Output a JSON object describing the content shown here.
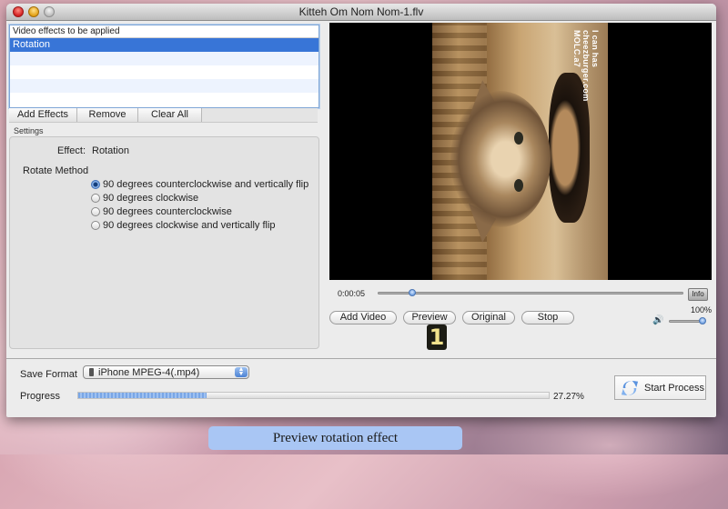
{
  "window": {
    "title": "Kitteh Om Nom Nom-1.flv"
  },
  "effects": {
    "header": "Video effects to be applied",
    "items": [
      "Rotation"
    ],
    "selected_index": 0,
    "buttons": {
      "add": "Add Effects",
      "remove": "Remove",
      "clear": "Clear All"
    }
  },
  "settings": {
    "title": "Settings",
    "effect_key": "Effect:",
    "effect_value": "Rotation",
    "rotate_label": "Rotate Method",
    "options": [
      {
        "label": "90 degrees counterclockwise and vertically flip",
        "selected": true
      },
      {
        "label": "90 degrees clockwise",
        "selected": false
      },
      {
        "label": "90 degrees counterclockwise",
        "selected": false
      },
      {
        "label": "90 degrees clockwise and vertically flip",
        "selected": false
      }
    ]
  },
  "player": {
    "watermark": "I can has cheezburger.com MOLC.a7",
    "time": "0:00:05",
    "seek_fraction": 0.1,
    "info_label": "Info",
    "buttons": {
      "add_video": "Add Video",
      "preview": "Preview",
      "original": "Original",
      "stop": "Stop"
    },
    "volume_label": "100%",
    "volume_fraction": 1.0,
    "speaker_icon": "speaker-icon"
  },
  "step_badge": "1",
  "output": {
    "save_format_label": "Save Format",
    "save_format_value": "iPhone MPEG-4(.mp4)",
    "progress_label": "Progress",
    "progress_percent": 27.27,
    "progress_text": "27.27%",
    "start_label": "Start Process"
  },
  "caption": "Preview rotation effect",
  "colors": {
    "selection": "#3875d7",
    "caption_bg": "#a9c6f4",
    "progress": "#79a6e6"
  }
}
